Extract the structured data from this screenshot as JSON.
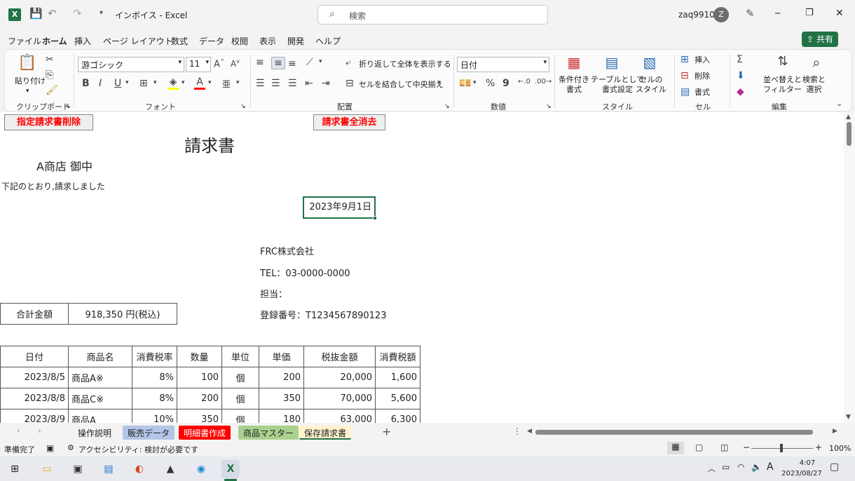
{
  "titlebar": {
    "doc_title": "インボイス - Excel",
    "search_placeholder": "検索",
    "user": "zaq9910",
    "avatar_letter": "Z",
    "minimize": "─",
    "restore": "❐",
    "close": "✕"
  },
  "menu": {
    "items": [
      "ファイル",
      "ホーム",
      "挿入",
      "ページ レイアウト",
      "数式",
      "データ",
      "校閲",
      "表示",
      "開発",
      "ヘルプ"
    ],
    "share": "共有"
  },
  "ribbon": {
    "clipboard": {
      "paste": "貼り付け",
      "label": "クリップボード"
    },
    "font": {
      "name": "游ゴシック",
      "size": "11",
      "label": "フォント",
      "bold": "B",
      "italic": "I",
      "underline": "U"
    },
    "alignment": {
      "wrap": "折り返して全体を表示する",
      "merge": "セルを結合して中央揃え",
      "label": "配置"
    },
    "number": {
      "format": "日付",
      "percent": "%",
      "comma": "9",
      "label": "数値"
    },
    "styles": {
      "cond": "条件付き\n書式",
      "table": "テーブルとして\n書式設定",
      "cell": "セルの\nスタイル",
      "label": "スタイル"
    },
    "cells": {
      "insert": "挿入",
      "delete": "削除",
      "format": "書式",
      "label": "セル"
    },
    "editing": {
      "sort": "並べ替えと\nフィルター",
      "find": "検索と\n選択",
      "label": "編集"
    }
  },
  "sheet": {
    "btn_delete": "指定請求書削除",
    "btn_clear": "請求書全消去",
    "title": "請求書",
    "customer": "A商店 御中",
    "intro": "下記のとおり,請求しました",
    "date": "2023年9月1日",
    "company": "FRC株式会社",
    "tel": "TEL：03-0000-0000",
    "person": "担当：",
    "regno": "登録番号：T1234567890123",
    "total_label": "合計金額",
    "total_value": "918,350 円(税込)",
    "headers": [
      "日付",
      "商品名",
      "消費税率",
      "数量",
      "単位",
      "単価",
      "税抜金額",
      "消費税額"
    ],
    "rows": [
      [
        "2023/8/5",
        "商品A※",
        "8%",
        "100",
        "個",
        "200",
        "20,000",
        "1,600"
      ],
      [
        "2023/8/8",
        "商品C※",
        "8%",
        "200",
        "個",
        "350",
        "70,000",
        "5,600"
      ],
      [
        "2023/8/9",
        "商品A",
        "10%",
        "350",
        "個",
        "180",
        "63,000",
        "6,300"
      ]
    ]
  },
  "tabs": [
    {
      "label": "操作説明",
      "bg": "#f3f3f3",
      "fg": "#222"
    },
    {
      "label": "販売データ",
      "bg": "#b4c6e7",
      "fg": "#222"
    },
    {
      "label": "明細書作成",
      "bg": "#ff0000",
      "fg": "#ffffff"
    },
    {
      "label": "商品マスター",
      "bg": "#a9d18e",
      "fg": "#222"
    },
    {
      "label": "保存請求書",
      "bg": "#fff2cc",
      "fg": "#222"
    }
  ],
  "status": {
    "ready": "準備完了",
    "accessibility": "アクセシビリティ: 検討が必要です",
    "zoom": "100%"
  },
  "taskbar": {
    "time": "4:07",
    "date": "2023/08/27",
    "ime": "A"
  },
  "colors": {
    "excel_green": "#217346",
    "red_text": "#ff0000"
  }
}
